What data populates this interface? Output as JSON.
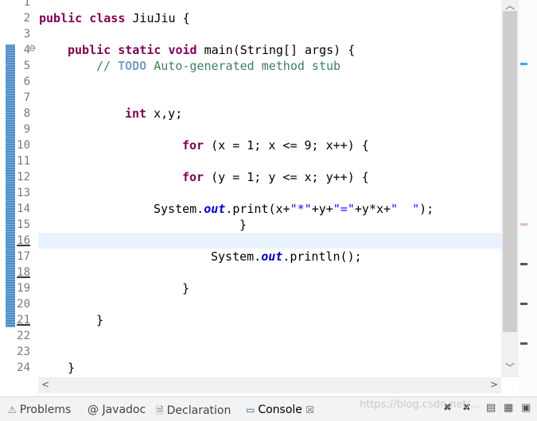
{
  "editor": {
    "class_line": {
      "kw1": "public",
      "kw2": "class",
      "rest": "JiuJiu {"
    },
    "main_line": {
      "kw1": "public",
      "kw2": "static",
      "kw3": "void",
      "rest": "main(String[] args) {"
    },
    "comment": {
      "slashes": "// ",
      "todo": "TODO",
      "text": " Auto-generated method stub"
    },
    "decl": {
      "kw": "int",
      "rest": " x,y;"
    },
    "for1": {
      "kw": "for",
      "rest": " (x = 1; x <= 9; x++) {"
    },
    "for2": {
      "kw": "for",
      "rest": " (y = 1; y <= x; y++) {"
    },
    "print": {
      "a": "System.",
      "field": "out",
      "b": ".print(x+",
      "s1": "\"*\"",
      "c": "+y+",
      "s2": "\"=\"",
      "d": "+y*x+",
      "s3": "\"  \"",
      "e": ");"
    },
    "close_inner": "}",
    "println": {
      "a": "System.",
      "field": "out",
      "b": ".println();"
    },
    "close_outer": "}",
    "close_main": "}",
    "close_class": "}"
  },
  "line_numbers": [
    "1",
    "2",
    "3",
    "4",
    "5",
    "6",
    "7",
    "8",
    "9",
    "10",
    "11",
    "12",
    "13",
    "14",
    "15",
    "16",
    "17",
    "18",
    "19",
    "20",
    "21",
    "22",
    "23",
    "24"
  ],
  "fold_glyph": "⊖",
  "tabs": [
    {
      "label": "Problems",
      "icon": "problems-icon",
      "glyph": "⚠"
    },
    {
      "label": "@ Javadoc",
      "icon": "javadoc-icon",
      "glyph": ""
    },
    {
      "label": "Declaration",
      "icon": "declaration-icon",
      "glyph": "🗎"
    },
    {
      "label": "Console",
      "icon": "console-icon",
      "glyph": "▭",
      "close": "☒"
    }
  ],
  "watermark": "https://blog.csdn.net/...",
  "colors": {
    "keyword": "#7f0055",
    "comment": "#3f7f5f",
    "field": "#0000c0",
    "string": "#2a00ff",
    "line_highlight": "#e8f2fe"
  }
}
